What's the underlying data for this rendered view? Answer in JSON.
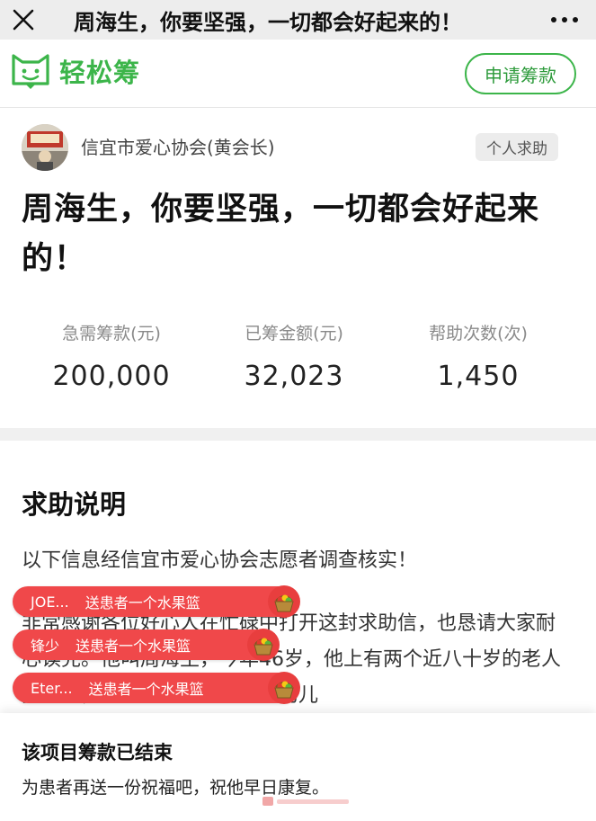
{
  "topbar": {
    "title": "周海生，你要坚强，一切都会好起来的！",
    "close_icon": "close-icon",
    "more_icon": "more-icon"
  },
  "brand": {
    "name": "轻松筹",
    "logo_icon": "cat-logo-icon",
    "apply_label": "申请筹款",
    "color": "#3cb54a"
  },
  "campaign": {
    "organizer": "信宜市爱心协会(黄会长)",
    "tag": "个人求助",
    "title": "周海生，你要坚强，一切都会好起来的！",
    "stats": [
      {
        "label": "急需筹款(元)",
        "value": "200,000"
      },
      {
        "label": "已筹金额(元)",
        "value": "32,023"
      },
      {
        "label": "帮助次数(次)",
        "value": "1,450"
      }
    ]
  },
  "description": {
    "title": "求助说明",
    "verified": "以下信息经信宜市爱心协会志愿者调查核实！",
    "story": "非常感谢各位好心人在忙碌中打开这封求助信，也恳请大家耐心读完。他叫周海生，今年46岁，他上有两个近八十岁的老人要照顾，下有两个在校读中学的儿"
  },
  "gifts": [
    {
      "user": "JOE...",
      "text": "送患者一个水果篮",
      "icon": "fruit-basket-icon"
    },
    {
      "user": "锋少",
      "text": "送患者一个水果篮",
      "icon": "fruit-basket-icon"
    },
    {
      "user": "Eter...",
      "text": "送患者一个水果篮",
      "icon": "fruit-basket-icon"
    }
  ],
  "footer": {
    "ended": "该项目筹款已结束",
    "wish": "为患者再送一份祝福吧，祝他早日康复。"
  },
  "accent": {
    "gift_red": "#f0484a"
  }
}
